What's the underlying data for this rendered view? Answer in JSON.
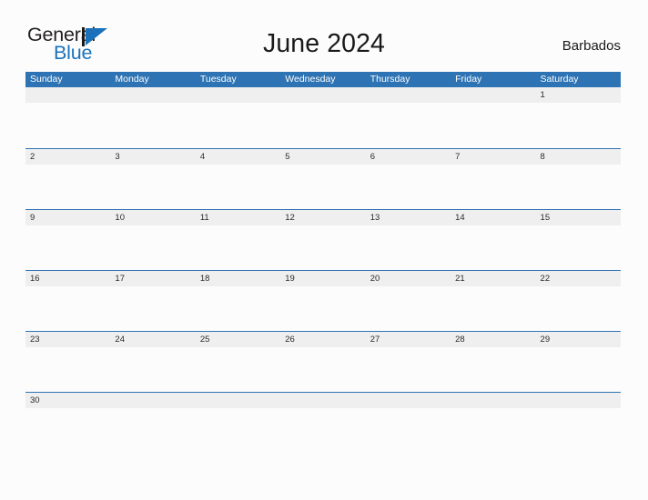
{
  "brand": {
    "name_part1": "General",
    "name_part2": "Blue",
    "mark": "triangle-flag-icon"
  },
  "header": {
    "title": "June 2024",
    "locale": "Barbados"
  },
  "colors": {
    "accent_blue": "#2e73b3",
    "logo_blue": "#1b72bb",
    "date_strip_gray": "#efefef",
    "page_background": "#fcfcfd",
    "header_text": "#ffffff",
    "day_number_text": "#2b2b2b"
  },
  "calendar": {
    "month": "June",
    "year": "2024",
    "weekdays": [
      "Sunday",
      "Monday",
      "Tuesday",
      "Wednesday",
      "Thursday",
      "Friday",
      "Saturday"
    ],
    "weeks": [
      [
        "",
        "",
        "",
        "",
        "",
        "",
        "1"
      ],
      [
        "2",
        "3",
        "4",
        "5",
        "6",
        "7",
        "8"
      ],
      [
        "9",
        "10",
        "11",
        "12",
        "13",
        "14",
        "15"
      ],
      [
        "16",
        "17",
        "18",
        "19",
        "20",
        "21",
        "22"
      ],
      [
        "23",
        "24",
        "25",
        "26",
        "27",
        "28",
        "29"
      ],
      [
        "30",
        "",
        "",
        "",
        "",
        "",
        ""
      ]
    ]
  }
}
